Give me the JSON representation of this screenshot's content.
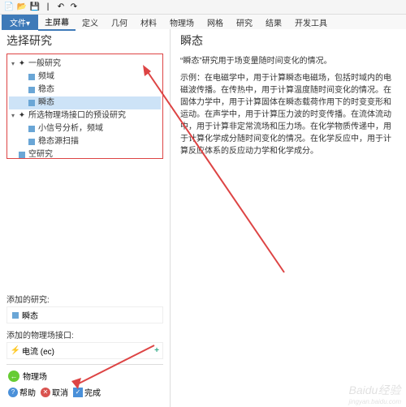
{
  "toolbar": {
    "icons": [
      "new",
      "open",
      "save",
      "undo",
      "redo"
    ]
  },
  "ribbon": {
    "file_label": "文件▾",
    "tabs": [
      "主屏幕",
      "定义",
      "几何",
      "材料",
      "物理场",
      "网格",
      "研究",
      "结果",
      "开发工具"
    ],
    "active_index": 0
  },
  "left_panel": {
    "title": "选择研究",
    "tree": {
      "group1_label": "一般研究",
      "group1_items": [
        "频域",
        "稳态",
        "瞬态"
      ],
      "group2_label": "所选物理场接口的预设研究",
      "group2_items": [
        "小信号分析，频域",
        "稳态源扫描"
      ],
      "empty_study_label": "空研究",
      "selected_index": 2
    },
    "added_study_label": "添加的研究:",
    "added_study_value": "瞬态",
    "added_interface_label": "添加的物理场接口:",
    "added_interface_value": "电流 (ec)",
    "back_label": "物理场",
    "help_label": "帮助",
    "cancel_label": "取消",
    "done_label": "完成"
  },
  "right_panel": {
    "title": "瞬态",
    "intro": "“瞬态”研究用于场变量随时间变化的情况。",
    "body": "示例：在电磁学中，用于计算瞬态电磁场，包括时域内的电磁波传播。在传热中，用于计算温度随时间变化的情况。在固体力学中，用于计算固体在瞬态载荷作用下的时变变形和运动。在声学中，用于计算压力波的时变传播。在流体流动中，用于计算非定常流场和压力场。在化学物质传递中，用于计算化学成分随时间变化的情况。在化学反应中，用于计算反应体系的反应动力学和化学成分。"
  },
  "watermark": {
    "brand": "Baidu经验",
    "url": "jingyan.baidu.com"
  }
}
